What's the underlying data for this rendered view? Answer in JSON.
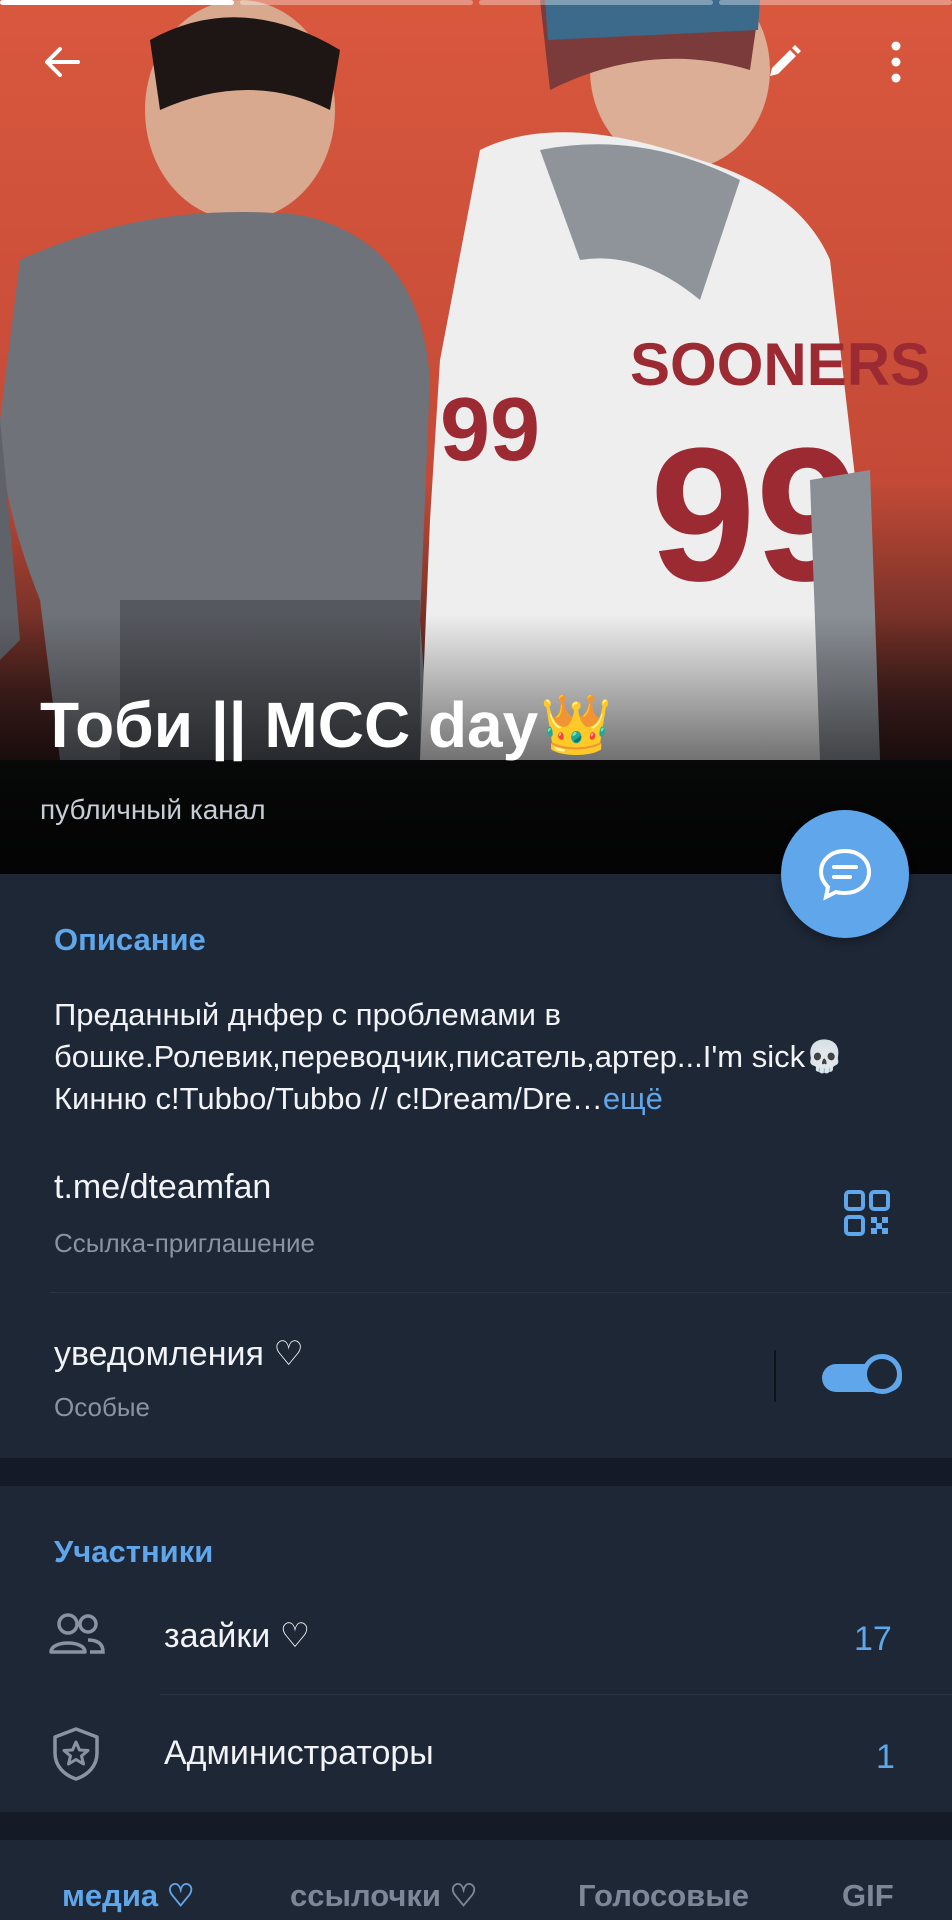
{
  "header": {
    "title": "Тоби || MCC day",
    "title_emoji": "👑",
    "subtitle": "публичный канал",
    "story_segments": 4,
    "icons": {
      "back": "arrow-left-icon",
      "edit": "pencil-icon",
      "more": "more-vertical-icon"
    }
  },
  "fab": {
    "icon": "chat-bubble-icon"
  },
  "description": {
    "heading": "Описание",
    "text": "Преданный днфер с проблемами в бошке.Ролевик,переводчик,писатель,артер...I'm sick💀 Кинню c!Tubbo/Tubbo // c!Dream/Dre",
    "more_label": "ещё"
  },
  "invite_link": {
    "value": "t.me/dteamfan",
    "caption": "Ссылка-приглашение",
    "icon": "qr-code-icon"
  },
  "notifications": {
    "title": "уведомления ♡",
    "caption": "Особые",
    "enabled": true
  },
  "members": {
    "heading": "Участники",
    "items": [
      {
        "icon": "people-icon",
        "label": "заайки ♡",
        "count": "17"
      },
      {
        "icon": "shield-star-icon",
        "label": "Администраторы",
        "count": "1"
      }
    ]
  },
  "media_tabs": [
    {
      "label": "медиа ♡",
      "active": true
    },
    {
      "label": "ссылочки ♡",
      "active": false
    },
    {
      "label": "Голосовые",
      "active": false
    },
    {
      "label": "GIF",
      "active": false
    }
  ],
  "colors": {
    "accent": "#5fa6ea",
    "background": "#1e2736",
    "separator": "#141b26"
  }
}
